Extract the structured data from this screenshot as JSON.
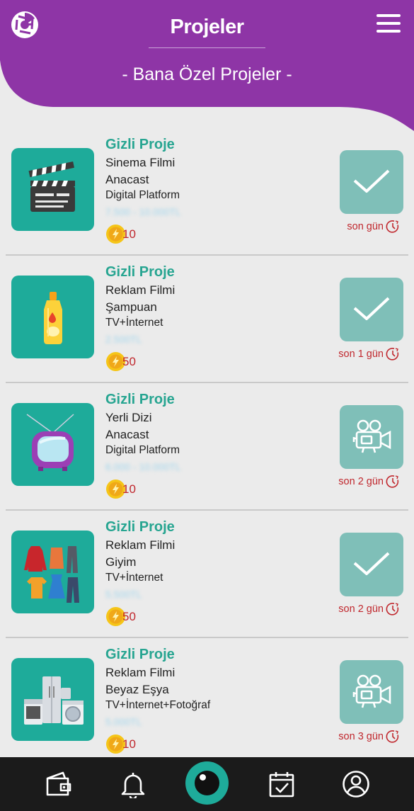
{
  "header": {
    "title": "Projeler",
    "subtitle": "- Bana Özel Projeler -",
    "brand_color": "#8e35a6"
  },
  "projects": [
    {
      "title": "Gizli Proje",
      "type": "Sinema Filmi",
      "subject": "Anacast",
      "platform": "Digital Platform",
      "budget_blurred": "7.500 - 10.000TL",
      "coins": "10",
      "deadline": "son gün",
      "action": "check-icon",
      "thumb": "clapperboard-icon"
    },
    {
      "title": "Gizli Proje",
      "type": "Reklam Filmi",
      "subject": "Şampuan",
      "platform": "TV+İnternet",
      "budget_blurred": "2.500TL",
      "coins": "50",
      "deadline": "son 1 gün",
      "action": "check-icon",
      "thumb": "shampoo-bottle-icon"
    },
    {
      "title": "Gizli Proje",
      "type": "Yerli Dizi",
      "subject": "Anacast",
      "platform": "Digital Platform",
      "budget_blurred": "6.000 - 10.000TL",
      "coins": "10",
      "deadline": "son 2 gün",
      "action": "video-camera-icon",
      "thumb": "television-icon"
    },
    {
      "title": "Gizli Proje",
      "type": "Reklam Filmi",
      "subject": "Giyim",
      "platform": "TV+İnternet",
      "budget_blurred": "5.500TL",
      "coins": "50",
      "deadline": "son 2 gün",
      "action": "check-icon",
      "thumb": "clothes-icon"
    },
    {
      "title": "Gizli Proje",
      "type": "Reklam Filmi",
      "subject": "Beyaz Eşya",
      "platform": "TV+İnternet+Fotoğraf",
      "budget_blurred": "5.000TL",
      "coins": "10",
      "deadline": "son 3 gün",
      "action": "video-camera-icon",
      "thumb": "appliances-icon"
    }
  ],
  "bottom_nav": {
    "items": [
      "wallet-icon",
      "bell-icon",
      "camera-lens-icon",
      "calendar-check-icon",
      "user-circle-icon"
    ]
  }
}
